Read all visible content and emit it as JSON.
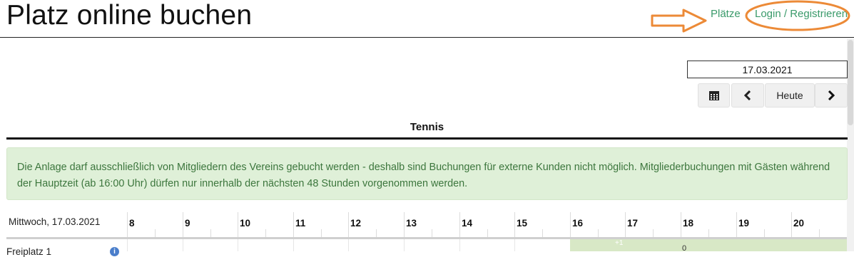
{
  "header": {
    "title": "Platz online buchen",
    "nav": {
      "places": "Plätze",
      "login": "Login / Registrieren"
    }
  },
  "annotation": {
    "arrow_color": "#ec8a37",
    "ellipse_color": "#ec8a37"
  },
  "date_picker": {
    "value": "17.03.2021",
    "calendar_icon": "calendar-icon",
    "prev_icon": "chevron-left-icon",
    "today_label": "Heute",
    "next_icon": "chevron-right-icon"
  },
  "sport": {
    "title": "Tennis"
  },
  "notice": {
    "text": "Die Anlage darf ausschließlich von Mitgliedern des Vereins gebucht werden - deshalb sind Buchungen für externe Kunden nicht möglich. Mitgliederbuchungen mit Gästen während der Hauptzeit (ab 16:00 Uhr) dürfen nur innerhalb der nächsten 48 Stunden vorgenommen werden."
  },
  "schedule": {
    "date_label": "Mittwoch, 17.03.2021",
    "hours": [
      "8",
      "9",
      "10",
      "11",
      "12",
      "13",
      "14",
      "15",
      "16",
      "17",
      "18",
      "19",
      "20"
    ],
    "courts": [
      {
        "name": "Freiplatz 1",
        "info_icon": "info-icon"
      }
    ],
    "peak_marker": "+1",
    "peak_count": "0"
  },
  "colors": {
    "link": "#3a9a6a",
    "notice_bg": "#dff0d8",
    "notice_text": "#3c763d",
    "peak_bg": "#d8e8c6"
  }
}
